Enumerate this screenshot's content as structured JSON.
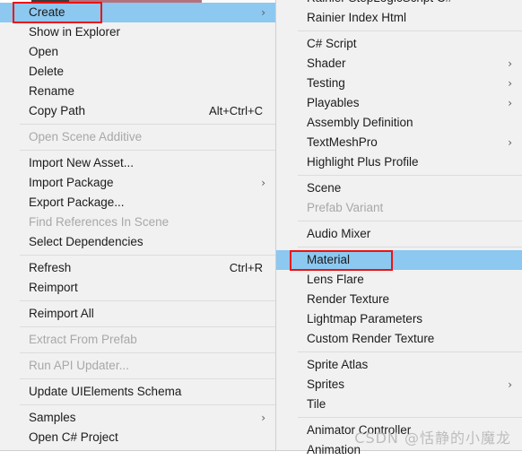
{
  "colors": {
    "menu_background": "#f1f1f1",
    "menu_border": "#cfcfcf",
    "highlight": "#8cc8f0",
    "annotation_red": "#ee1111",
    "text": "#1b1b1b",
    "text_disabled": "#a8a8a8",
    "separator": "#dcdcdc",
    "watermark": "#bdbdbd",
    "bg_strip_dark": "#3b3b3b",
    "bg_strip_pink": "#b4727f"
  },
  "context_menu": {
    "name": "assets-context-menu",
    "items": [
      {
        "label": "Create",
        "arrow": true,
        "disabled": false,
        "highlighted": true,
        "shortcut": ""
      },
      {
        "label": "Show in Explorer",
        "arrow": false,
        "disabled": false,
        "highlighted": false,
        "shortcut": ""
      },
      {
        "label": "Open",
        "arrow": false,
        "disabled": false,
        "highlighted": false,
        "shortcut": ""
      },
      {
        "label": "Delete",
        "arrow": false,
        "disabled": false,
        "highlighted": false,
        "shortcut": ""
      },
      {
        "label": "Rename",
        "arrow": false,
        "disabled": false,
        "highlighted": false,
        "shortcut": ""
      },
      {
        "label": "Copy Path",
        "arrow": false,
        "disabled": false,
        "highlighted": false,
        "shortcut": "Alt+Ctrl+C"
      },
      {
        "separator": true
      },
      {
        "label": "Open Scene Additive",
        "arrow": false,
        "disabled": true,
        "highlighted": false,
        "shortcut": ""
      },
      {
        "separator": true
      },
      {
        "label": "Import New Asset...",
        "arrow": false,
        "disabled": false,
        "highlighted": false,
        "shortcut": ""
      },
      {
        "label": "Import Package",
        "arrow": true,
        "disabled": false,
        "highlighted": false,
        "shortcut": ""
      },
      {
        "label": "Export Package...",
        "arrow": false,
        "disabled": false,
        "highlighted": false,
        "shortcut": ""
      },
      {
        "label": "Find References In Scene",
        "arrow": false,
        "disabled": true,
        "highlighted": false,
        "shortcut": ""
      },
      {
        "label": "Select Dependencies",
        "arrow": false,
        "disabled": false,
        "highlighted": false,
        "shortcut": ""
      },
      {
        "separator": true
      },
      {
        "label": "Refresh",
        "arrow": false,
        "disabled": false,
        "highlighted": false,
        "shortcut": "Ctrl+R"
      },
      {
        "label": "Reimport",
        "arrow": false,
        "disabled": false,
        "highlighted": false,
        "shortcut": ""
      },
      {
        "separator": true
      },
      {
        "label": "Reimport All",
        "arrow": false,
        "disabled": false,
        "highlighted": false,
        "shortcut": ""
      },
      {
        "separator": true
      },
      {
        "label": "Extract From Prefab",
        "arrow": false,
        "disabled": true,
        "highlighted": false,
        "shortcut": ""
      },
      {
        "separator": true
      },
      {
        "label": "Run API Updater...",
        "arrow": false,
        "disabled": true,
        "highlighted": false,
        "shortcut": ""
      },
      {
        "separator": true
      },
      {
        "label": "Update UIElements Schema",
        "arrow": false,
        "disabled": false,
        "highlighted": false,
        "shortcut": ""
      },
      {
        "separator": true
      },
      {
        "label": "Samples",
        "arrow": true,
        "disabled": false,
        "highlighted": false,
        "shortcut": ""
      },
      {
        "label": "Open C# Project",
        "arrow": false,
        "disabled": false,
        "highlighted": false,
        "shortcut": ""
      }
    ]
  },
  "create_submenu": {
    "name": "create-submenu",
    "items": [
      {
        "label": "Rainier StepLogicScript C#",
        "arrow": false,
        "disabled": false,
        "highlighted": false,
        "clipped_top": true
      },
      {
        "label": "Rainier Index Html",
        "arrow": false,
        "disabled": false,
        "highlighted": false
      },
      {
        "separator": true
      },
      {
        "label": "C# Script",
        "arrow": false,
        "disabled": false,
        "highlighted": false
      },
      {
        "label": "Shader",
        "arrow": true,
        "disabled": false,
        "highlighted": false
      },
      {
        "label": "Testing",
        "arrow": true,
        "disabled": false,
        "highlighted": false
      },
      {
        "label": "Playables",
        "arrow": true,
        "disabled": false,
        "highlighted": false
      },
      {
        "label": "Assembly Definition",
        "arrow": false,
        "disabled": false,
        "highlighted": false
      },
      {
        "label": "TextMeshPro",
        "arrow": true,
        "disabled": false,
        "highlighted": false
      },
      {
        "label": "Highlight Plus Profile",
        "arrow": false,
        "disabled": false,
        "highlighted": false
      },
      {
        "separator": true
      },
      {
        "label": "Scene",
        "arrow": false,
        "disabled": false,
        "highlighted": false
      },
      {
        "label": "Prefab Variant",
        "arrow": false,
        "disabled": true,
        "highlighted": false
      },
      {
        "separator": true
      },
      {
        "label": "Audio Mixer",
        "arrow": false,
        "disabled": false,
        "highlighted": false
      },
      {
        "separator": true
      },
      {
        "label": "Material",
        "arrow": false,
        "disabled": false,
        "highlighted": true
      },
      {
        "label": "Lens Flare",
        "arrow": false,
        "disabled": false,
        "highlighted": false
      },
      {
        "label": "Render Texture",
        "arrow": false,
        "disabled": false,
        "highlighted": false
      },
      {
        "label": "Lightmap Parameters",
        "arrow": false,
        "disabled": false,
        "highlighted": false
      },
      {
        "label": "Custom Render Texture",
        "arrow": false,
        "disabled": false,
        "highlighted": false
      },
      {
        "separator": true
      },
      {
        "label": "Sprite Atlas",
        "arrow": false,
        "disabled": false,
        "highlighted": false
      },
      {
        "label": "Sprites",
        "arrow": true,
        "disabled": false,
        "highlighted": false
      },
      {
        "label": "Tile",
        "arrow": false,
        "disabled": false,
        "highlighted": false
      },
      {
        "separator": true
      },
      {
        "label": "Animator Controller",
        "arrow": false,
        "disabled": false,
        "highlighted": false
      },
      {
        "label": "Animation",
        "arrow": false,
        "disabled": false,
        "highlighted": false,
        "clipped_bottom": true
      }
    ]
  },
  "annotations": [
    {
      "name": "create-annotation",
      "target": "Create"
    },
    {
      "name": "material-annotation",
      "target": "Material"
    }
  ],
  "icons": {
    "submenu_arrow": "chevron-right-icon"
  },
  "watermark": {
    "text": "CSDN @恬静的小魔龙"
  }
}
